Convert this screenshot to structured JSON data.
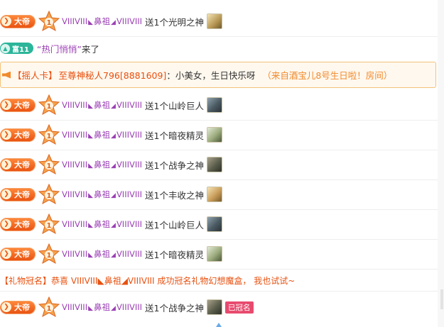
{
  "badges": {
    "emperor": "大帝",
    "wealth": "富11"
  },
  "user": {
    "part1": "VIIIVIII",
    "part2": "鼻祖",
    "part3": "VIIIVIII"
  },
  "give_prefix": "送1个",
  "rows": [
    {
      "gift": "光明之神",
      "icon": "light-god-gift-icon"
    },
    {
      "gift": "山岭巨人",
      "icon": "mountain-giant-gift-icon"
    },
    {
      "gift": "暗夜精灵",
      "icon": "night-elf-gift-icon"
    },
    {
      "gift": "战争之神",
      "icon": "war-god-gift-icon"
    },
    {
      "gift": "丰收之神",
      "icon": "harvest-god-gift-icon"
    },
    {
      "gift": "山岭巨人",
      "icon": "mountain-giant-gift-icon"
    },
    {
      "gift": "暗夜精灵",
      "icon": "night-elf-gift-icon"
    },
    {
      "gift": "战争之神",
      "icon": "war-god-gift-icon",
      "tag": "已冠名"
    }
  ],
  "enter": {
    "name": "“热门悄悄”",
    "rest": "来了"
  },
  "shake": {
    "label": "【摇人卡】",
    "sender": "至尊神秘人796[8881609]",
    "message": "：小美女，生日快乐呀",
    "from": "（来自酒宝儿8号生日啦！房间）"
  },
  "crown": {
    "text": "【礼物冠名】恭喜 VIIIVIII◣鼻祖◢VIIIVIII 成功冠名礼物幻想魔盒， 我也试试~"
  },
  "colors": {
    "username": "#9b3fb4",
    "emperor_badge": "#e8500f",
    "wealth_badge": "#2bb59a",
    "crowned_tag": "#e84a6e",
    "shake_border": "#f3c27a"
  }
}
